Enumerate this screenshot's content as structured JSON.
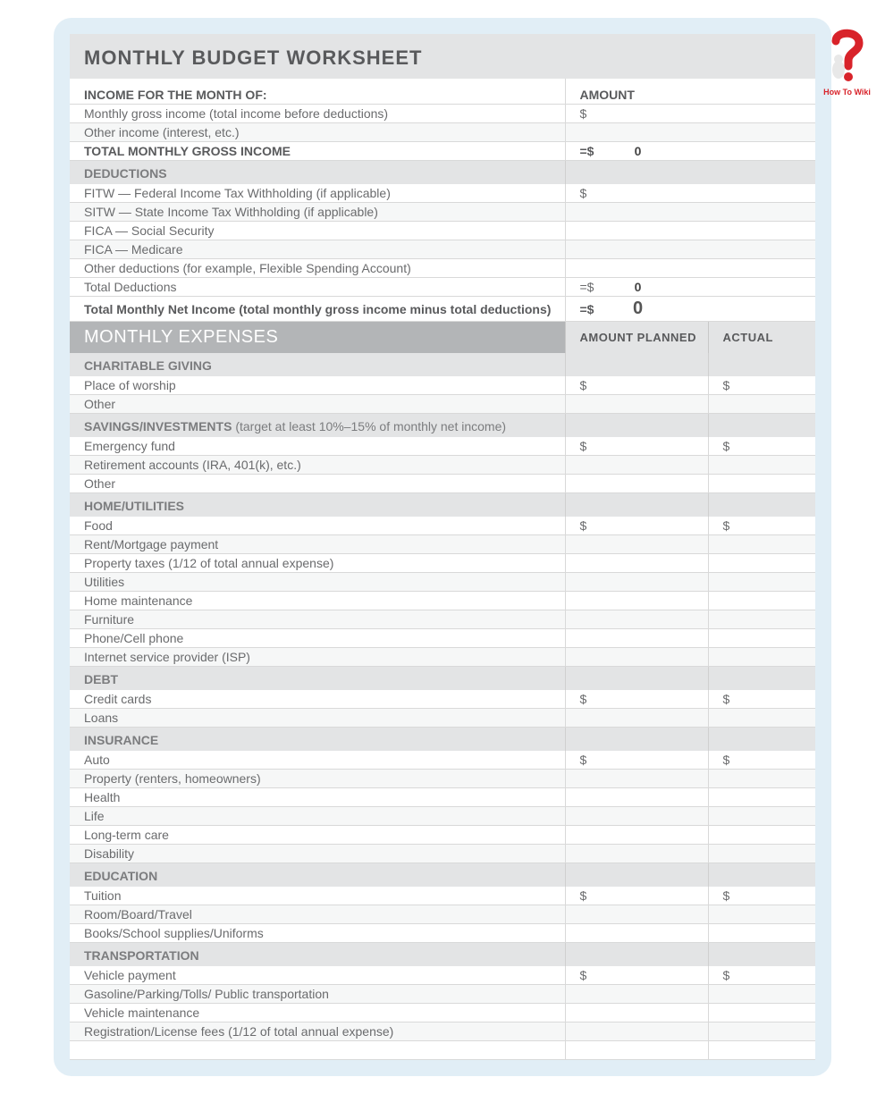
{
  "logo_text": "How To Wiki",
  "title": "MONTHLY BUDGET WORKSHEET",
  "income": {
    "header_label": "INCOME FOR THE MONTH OF:",
    "amount_header": "AMOUNT",
    "rows": [
      {
        "label": "Monthly gross income (total income before deductions)",
        "amount": "$"
      },
      {
        "label": "Other income (interest, etc.)",
        "amount": ""
      }
    ],
    "total_label": "TOTAL MONTHLY GROSS INCOME",
    "total_prefix": "=$",
    "total_value": "0"
  },
  "deductions": {
    "header": "DEDUCTIONS",
    "rows": [
      {
        "label": "FITW — Federal Income Tax Withholding (if applicable)",
        "amount": "$"
      },
      {
        "label": "SITW — State Income Tax Withholding (if applicable)",
        "amount": ""
      },
      {
        "label": "FICA — Social Security",
        "amount": ""
      },
      {
        "label": "FICA — Medicare",
        "amount": ""
      },
      {
        "label": "Other deductions (for example, Flexible Spending Account)",
        "amount": ""
      }
    ],
    "total_label": "Total Deductions",
    "total_prefix": "=$",
    "total_value": "0",
    "net_label": "Total Monthly Net Income (total monthly gross income minus total deductions)",
    "net_prefix": "=$",
    "net_value": "0"
  },
  "expenses": {
    "header": "MONTHLY EXPENSES",
    "col_planned": "AMOUNT PLANNED",
    "col_actual": "ACTUAL",
    "sections": [
      {
        "title": "CHARITABLE GIVING",
        "rows": [
          {
            "label": "Place of worship",
            "planned": "$",
            "actual": "$"
          },
          {
            "label": "Other",
            "planned": "",
            "actual": ""
          }
        ]
      },
      {
        "title": "SAVINGS/INVESTMENTS",
        "note": " (target at least 10%–15% of monthly net income)",
        "rows": [
          {
            "label": "Emergency fund",
            "planned": "$",
            "actual": "$"
          },
          {
            "label": "Retirement accounts (IRA, 401(k), etc.)",
            "planned": "",
            "actual": ""
          },
          {
            "label": "Other",
            "planned": "",
            "actual": ""
          }
        ]
      },
      {
        "title": "HOME/UTILITIES",
        "rows": [
          {
            "label": "Food",
            "planned": "$",
            "actual": "$"
          },
          {
            "label": "Rent/Mortgage payment",
            "planned": "",
            "actual": ""
          },
          {
            "label": "Property taxes (1/12 of total annual expense)",
            "planned": "",
            "actual": ""
          },
          {
            "label": "Utilities",
            "planned": "",
            "actual": ""
          },
          {
            "label": "Home maintenance",
            "planned": "",
            "actual": ""
          },
          {
            "label": "Furniture",
            "planned": "",
            "actual": ""
          },
          {
            "label": "Phone/Cell phone",
            "planned": "",
            "actual": ""
          },
          {
            "label": "Internet service provider (ISP)",
            "planned": "",
            "actual": ""
          }
        ]
      },
      {
        "title": "DEBT",
        "rows": [
          {
            "label": "Credit cards",
            "planned": "$",
            "actual": "$"
          },
          {
            "label": "Loans",
            "planned": "",
            "actual": ""
          }
        ]
      },
      {
        "title": "INSURANCE",
        "rows": [
          {
            "label": "Auto",
            "planned": "$",
            "actual": "$"
          },
          {
            "label": "Property (renters, homeowners)",
            "planned": "",
            "actual": ""
          },
          {
            "label": "Health",
            "planned": "",
            "actual": ""
          },
          {
            "label": "Life",
            "planned": "",
            "actual": ""
          },
          {
            "label": "Long-term care",
            "planned": "",
            "actual": ""
          },
          {
            "label": "Disability",
            "planned": "",
            "actual": ""
          }
        ]
      },
      {
        "title": "EDUCATION",
        "rows": [
          {
            "label": "Tuition",
            "planned": "$",
            "actual": "$"
          },
          {
            "label": "Room/Board/Travel",
            "planned": "",
            "actual": ""
          },
          {
            "label": "Books/School supplies/Uniforms",
            "planned": "",
            "actual": ""
          }
        ]
      },
      {
        "title": "TRANSPORTATION",
        "rows": [
          {
            "label": "Vehicle payment",
            "planned": "$",
            "actual": "$"
          },
          {
            "label": "Gasoline/Parking/Tolls/ Public transportation",
            "planned": "",
            "actual": ""
          },
          {
            "label": "Vehicle maintenance",
            "planned": "",
            "actual": ""
          },
          {
            "label": "Registration/License fees (1/12 of total annual expense)",
            "planned": "",
            "actual": ""
          }
        ]
      }
    ]
  }
}
